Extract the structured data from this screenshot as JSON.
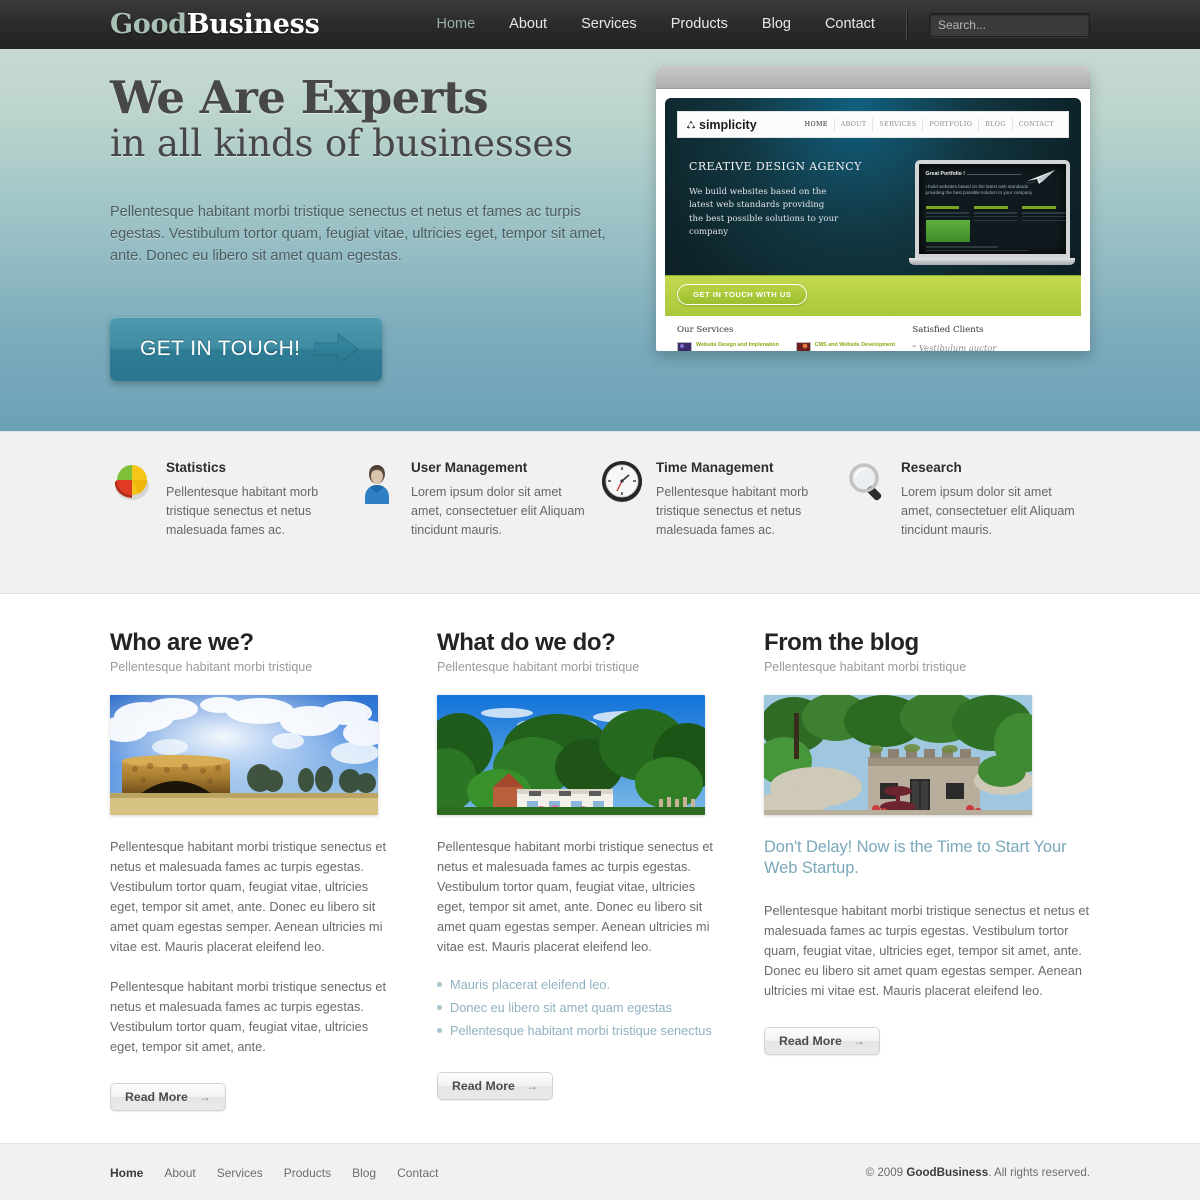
{
  "header": {
    "logo_good": "Good",
    "logo_business": "Business",
    "nav": [
      {
        "label": "Home",
        "active": true
      },
      {
        "label": "About",
        "active": false
      },
      {
        "label": "Services",
        "active": false
      },
      {
        "label": "Products",
        "active": false
      },
      {
        "label": "Blog",
        "active": false
      },
      {
        "label": "Contact",
        "active": false
      }
    ],
    "search_placeholder": "Search...",
    "search_value": "",
    "search_button_icon": "arrow-right-icon"
  },
  "hero": {
    "title_line1": "We Are Experts",
    "title_line2": "in all kinds of businesses",
    "description": "Pellentesque habitant morbi tristique senectus et netus et fames ac turpis egestas. Vestibulum tortor quam, feugiat vitae, ultricies eget, tempor sit amet, ante. Donec eu libero sit amet quam egestas.",
    "cta_label": "GET IN TOUCH!",
    "cta_icon": "arrow-right-icon",
    "preview": {
      "logo": "simplicity",
      "logo_icon": "recycle-icon",
      "nav": [
        "HOME",
        "ABOUT",
        "SERVICES",
        "PORTFOLIO",
        "BLOG",
        "CONTACT"
      ],
      "heading": "CREATIVE DESIGN AGENCY",
      "paragraph": "We build websites based on the latest web standards providing the best possible solutions to your company",
      "button": "GET IN TOUCH WITH US",
      "laptop_title": "Great Portfolio !",
      "laptop_text": "I build websites based on the latest web standards providing the best possible solution to your company",
      "services_heading": "Our Services",
      "services": [
        "Website Design and Implenation",
        "CMS and Website Development"
      ],
      "clients_heading": "Satisfied Clients",
      "clients_quote": "\" Vestibulum auctor"
    }
  },
  "features": [
    {
      "icon": "pie-chart-icon",
      "title": "Statistics",
      "text": "Pellentesque habitant morb tristique senectus et netus malesuada fames ac."
    },
    {
      "icon": "user-icon",
      "title": "User Management",
      "text": "Lorem ipsum dolor sit amet amet, consectetuer elit Aliquam tincidunt mauris."
    },
    {
      "icon": "clock-icon",
      "title": "Time Management",
      "text": "Pellentesque habitant morb tristique senectus et netus malesuada fames ac."
    },
    {
      "icon": "magnifier-icon",
      "title": "Research",
      "text": "Lorem ipsum dolor sit amet amet, consectetuer elit Aliquam tincidunt mauris."
    }
  ],
  "columns": {
    "who": {
      "heading": "Who are we?",
      "subheading": "Pellentesque habitant morbi tristique",
      "image_alt": "stone-structure-under-blue-sky-photo",
      "paragraph1": "Pellentesque habitant morbi tristique senectus et netus et malesuada fames ac turpis egestas. Vestibulum tortor quam, feugiat vitae, ultricies eget, tempor sit amet, ante. Donec eu libero sit amet quam egestas semper. Aenean ultricies mi vitae est. Mauris placerat eleifend leo.",
      "paragraph2": "Pellentesque habitant morbi tristique senectus et netus et malesuada fames ac turpis egestas. Vestibulum tortor quam, feugiat vitae, ultricies eget, tempor sit amet, ante.",
      "button": "Read More",
      "button_icon": "arrow-right-icon"
    },
    "what": {
      "heading": "What do we do?",
      "subheading": "Pellentesque habitant morbi tristique",
      "image_alt": "white-house-among-green-trees-photo",
      "paragraph1": "Pellentesque habitant morbi tristique senectus et netus et malesuada fames ac turpis egestas. Vestibulum tortor quam, feugiat vitae, ultricies eget, tempor sit amet, ante. Donec eu libero sit amet quam egestas semper. Aenean ultricies mi vitae est. Mauris placerat eleifend leo.",
      "bullets": [
        "Mauris placerat eleifend leo.",
        "Donec eu libero sit amet quam egestas",
        "Pellentesque habitant morbi tristique senectus"
      ],
      "button": "Read More",
      "button_icon": "arrow-right-icon"
    },
    "blog": {
      "heading": "From the blog",
      "subheading": "Pellentesque habitant morbi tristique",
      "image_alt": "stone-building-with-fountain-photo",
      "post_title": "Don't Delay! Now is the Time to Start Your Web Startup.",
      "paragraph1": "Pellentesque habitant morbi tristique senectus et netus et malesuada fames ac turpis egestas. Vestibulum tortor quam, feugiat vitae, ultricies eget, tempor sit amet, ante. Donec eu libero sit amet quam egestas semper. Aenean ultricies mi vitae est. Mauris placerat eleifend leo.",
      "button": "Read More",
      "button_icon": "arrow-right-icon"
    }
  },
  "footer": {
    "nav": [
      {
        "label": "Home",
        "active": true
      },
      {
        "label": "About",
        "active": false
      },
      {
        "label": "Services",
        "active": false
      },
      {
        "label": "Products",
        "active": false
      },
      {
        "label": "Blog",
        "active": false
      },
      {
        "label": "Contact",
        "active": false
      }
    ],
    "copyright_prefix": "© 2009 ",
    "copyright_brand": "GoodBusiness",
    "copyright_suffix": ". All rights reserved."
  },
  "colors": {
    "accent_teal": "#3e8ca3",
    "brand_sage": "#a9c0b5",
    "link_blue": "#7aa8bb",
    "header_dark": "#2b2b2b"
  }
}
